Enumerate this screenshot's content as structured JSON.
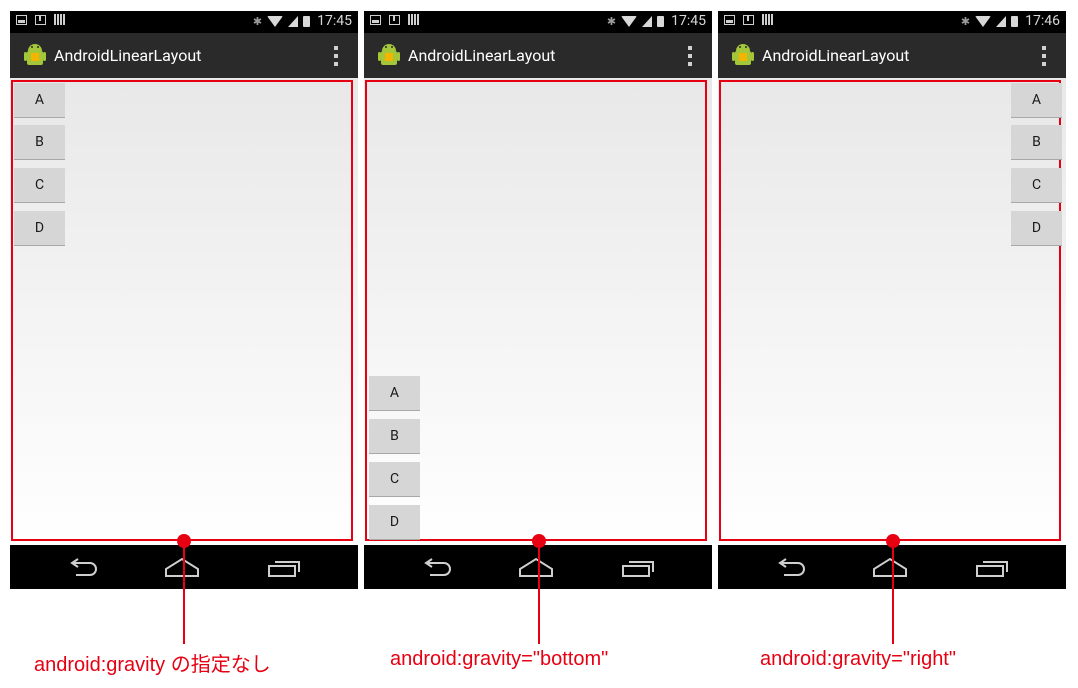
{
  "screens": [
    {
      "clock": "17:45",
      "app_title": "AndroidLinearLayout",
      "buttons": [
        "A",
        "B",
        "C",
        "D"
      ],
      "caption": "android:gravity の指定なし"
    },
    {
      "clock": "17:45",
      "app_title": "AndroidLinearLayout",
      "buttons": [
        "A",
        "B",
        "C",
        "D"
      ],
      "caption": "android:gravity=\"bottom\""
    },
    {
      "clock": "17:46",
      "app_title": "AndroidLinearLayout",
      "buttons": [
        "A",
        "B",
        "C",
        "D"
      ],
      "caption": "android:gravity=\"right\""
    }
  ],
  "colors": {
    "annotation_red": "#e60012",
    "action_bar": "#2a2a2a",
    "status_bar": "#000000",
    "button_bg": "#d6d6d6"
  },
  "icons": [
    "picture-icon",
    "download-icon",
    "barcode-icon",
    "bluetooth-icon",
    "wifi-icon",
    "signal-icon",
    "battery-icon",
    "android-app-icon",
    "overflow-menu-icon",
    "back-icon",
    "home-icon",
    "recent-apps-icon"
  ]
}
